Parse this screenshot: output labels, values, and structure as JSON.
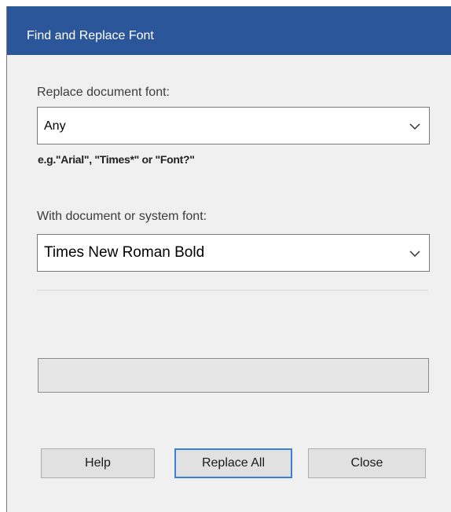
{
  "dialog": {
    "title": "Find and Replace Font",
    "replace_label": "Replace document font:",
    "replace_value": "Any",
    "hint": "e.g.\"Arial\",  \"Times*\" or \"Font?\"",
    "with_label": "With document or system font:",
    "with_value": "Times New Roman Bold",
    "progress_fraction": 0,
    "buttons": {
      "help": "Help",
      "replace_all": "Replace All",
      "close": "Close"
    }
  },
  "colors": {
    "titlebar": "#2b579a",
    "dialog_bg": "#f0f0f0",
    "default_button_border": "#3c7fd4"
  },
  "icons": {
    "dropdown": "chevron-down-icon"
  }
}
